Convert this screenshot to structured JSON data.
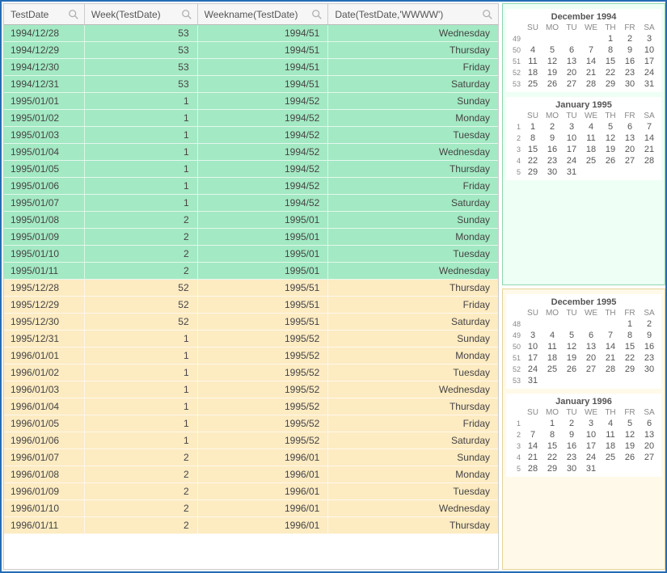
{
  "columns": [
    "TestDate",
    "Week(TestDate)",
    "Weekname(TestDate)",
    "Date(TestDate,'WWWW')"
  ],
  "rows": [
    {
      "g": "green",
      "c": [
        "1994/12/28",
        "53",
        "1994/51",
        "Wednesday"
      ]
    },
    {
      "g": "green",
      "c": [
        "1994/12/29",
        "53",
        "1994/51",
        "Thursday"
      ]
    },
    {
      "g": "green",
      "c": [
        "1994/12/30",
        "53",
        "1994/51",
        "Friday"
      ]
    },
    {
      "g": "green",
      "c": [
        "1994/12/31",
        "53",
        "1994/51",
        "Saturday"
      ]
    },
    {
      "g": "green",
      "c": [
        "1995/01/01",
        "1",
        "1994/52",
        "Sunday"
      ]
    },
    {
      "g": "green",
      "c": [
        "1995/01/02",
        "1",
        "1994/52",
        "Monday"
      ]
    },
    {
      "g": "green",
      "c": [
        "1995/01/03",
        "1",
        "1994/52",
        "Tuesday"
      ]
    },
    {
      "g": "green",
      "c": [
        "1995/01/04",
        "1",
        "1994/52",
        "Wednesday"
      ]
    },
    {
      "g": "green",
      "c": [
        "1995/01/05",
        "1",
        "1994/52",
        "Thursday"
      ]
    },
    {
      "g": "green",
      "c": [
        "1995/01/06",
        "1",
        "1994/52",
        "Friday"
      ]
    },
    {
      "g": "green",
      "c": [
        "1995/01/07",
        "1",
        "1994/52",
        "Saturday"
      ]
    },
    {
      "g": "green",
      "c": [
        "1995/01/08",
        "2",
        "1995/01",
        "Sunday"
      ]
    },
    {
      "g": "green",
      "c": [
        "1995/01/09",
        "2",
        "1995/01",
        "Monday"
      ]
    },
    {
      "g": "green",
      "c": [
        "1995/01/10",
        "2",
        "1995/01",
        "Tuesday"
      ]
    },
    {
      "g": "green",
      "c": [
        "1995/01/11",
        "2",
        "1995/01",
        "Wednesday"
      ]
    },
    {
      "g": "yellow",
      "c": [
        "1995/12/28",
        "52",
        "1995/51",
        "Thursday"
      ]
    },
    {
      "g": "yellow",
      "c": [
        "1995/12/29",
        "52",
        "1995/51",
        "Friday"
      ]
    },
    {
      "g": "yellow",
      "c": [
        "1995/12/30",
        "52",
        "1995/51",
        "Saturday"
      ]
    },
    {
      "g": "yellow",
      "c": [
        "1995/12/31",
        "1",
        "1995/52",
        "Sunday"
      ]
    },
    {
      "g": "yellow",
      "c": [
        "1996/01/01",
        "1",
        "1995/52",
        "Monday"
      ]
    },
    {
      "g": "yellow",
      "c": [
        "1996/01/02",
        "1",
        "1995/52",
        "Tuesday"
      ]
    },
    {
      "g": "yellow",
      "c": [
        "1996/01/03",
        "1",
        "1995/52",
        "Wednesday"
      ]
    },
    {
      "g": "yellow",
      "c": [
        "1996/01/04",
        "1",
        "1995/52",
        "Thursday"
      ]
    },
    {
      "g": "yellow",
      "c": [
        "1996/01/05",
        "1",
        "1995/52",
        "Friday"
      ]
    },
    {
      "g": "yellow",
      "c": [
        "1996/01/06",
        "1",
        "1995/52",
        "Saturday"
      ]
    },
    {
      "g": "yellow",
      "c": [
        "1996/01/07",
        "2",
        "1996/01",
        "Sunday"
      ]
    },
    {
      "g": "yellow",
      "c": [
        "1996/01/08",
        "2",
        "1996/01",
        "Monday"
      ]
    },
    {
      "g": "yellow",
      "c": [
        "1996/01/09",
        "2",
        "1996/01",
        "Tuesday"
      ]
    },
    {
      "g": "yellow",
      "c": [
        "1996/01/10",
        "2",
        "1996/01",
        "Wednesday"
      ]
    },
    {
      "g": "yellow",
      "c": [
        "1996/01/11",
        "2",
        "1996/01",
        "Thursday"
      ]
    }
  ],
  "dow": [
    "SU",
    "MO",
    "TU",
    "WE",
    "TH",
    "FR",
    "SA"
  ],
  "calendars": [
    {
      "group": "green",
      "months": [
        {
          "title": "December 1994",
          "startDow": 4,
          "days": 31,
          "firstWeek": 49
        },
        {
          "title": "January 1995",
          "startDow": 0,
          "days": 31,
          "firstWeek": 1
        }
      ]
    },
    {
      "group": "yellow",
      "months": [
        {
          "title": "December 1995",
          "startDow": 5,
          "days": 31,
          "firstWeek": 48
        },
        {
          "title": "January 1996",
          "startDow": 1,
          "days": 31,
          "firstWeek": 1
        }
      ]
    }
  ]
}
